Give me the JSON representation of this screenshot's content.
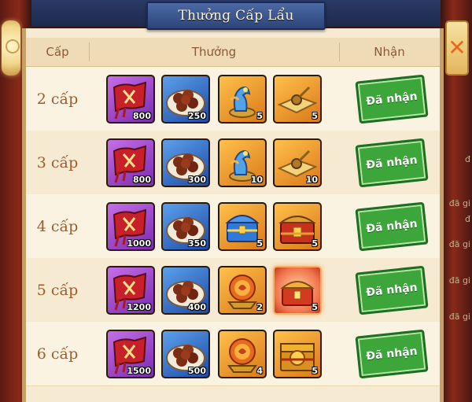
{
  "window": {
    "title": "Thưởng Cấp Lẩu"
  },
  "headers": {
    "level": "Cấp",
    "reward": "Thưởng",
    "claim": "Nhận"
  },
  "side_text": [
    "đ",
    "đã gi",
    "đ",
    "đã gi",
    "đã gi",
    "đã gi"
  ],
  "claimed_label": "Đã nhận",
  "rows": [
    {
      "level": "2 cấp",
      "items": [
        {
          "name": "red-banner-icon",
          "rarity": "purple",
          "qty": "800"
        },
        {
          "name": "chestnut-plate-icon",
          "rarity": "blue",
          "qty": "250"
        },
        {
          "name": "blue-dragon-statue-icon",
          "rarity": "orange",
          "qty": "5"
        },
        {
          "name": "golden-tray-icon",
          "rarity": "orange",
          "qty": "5"
        }
      ]
    },
    {
      "level": "3 cấp",
      "items": [
        {
          "name": "red-banner-icon",
          "rarity": "purple",
          "qty": "800"
        },
        {
          "name": "chestnut-plate-icon",
          "rarity": "blue",
          "qty": "300"
        },
        {
          "name": "blue-dragon-statue-icon",
          "rarity": "orange",
          "qty": "10"
        },
        {
          "name": "golden-tray-icon",
          "rarity": "orange",
          "qty": "10"
        }
      ]
    },
    {
      "level": "4 cấp",
      "items": [
        {
          "name": "red-banner-icon",
          "rarity": "purple",
          "qty": "1000"
        },
        {
          "name": "chestnut-plate-icon",
          "rarity": "blue",
          "qty": "350"
        },
        {
          "name": "blue-treasure-chest-icon",
          "rarity": "orange",
          "qty": "5"
        },
        {
          "name": "gold-treasure-chest-icon",
          "rarity": "orange",
          "qty": "5"
        }
      ]
    },
    {
      "level": "5 cấp",
      "items": [
        {
          "name": "red-banner-icon",
          "rarity": "purple",
          "qty": "1200"
        },
        {
          "name": "chestnut-plate-icon",
          "rarity": "blue",
          "qty": "400"
        },
        {
          "name": "gold-coin-stand-icon",
          "rarity": "orange",
          "qty": "2"
        },
        {
          "name": "glowing-treasure-chest-icon",
          "rarity": "red",
          "qty": "5"
        }
      ]
    },
    {
      "level": "6 cấp",
      "items": [
        {
          "name": "red-banner-icon",
          "rarity": "purple",
          "qty": "1500"
        },
        {
          "name": "chestnut-plate-icon",
          "rarity": "blue",
          "qty": "500"
        },
        {
          "name": "gold-coin-stand-icon",
          "rarity": "orange",
          "qty": "4"
        },
        {
          "name": "gold-coin-box-icon",
          "rarity": "orange",
          "qty": "5"
        }
      ]
    }
  ],
  "colors": {
    "panel": "#f6ead2",
    "header": "#efdcb6",
    "claimed_green": "#3da63b",
    "title_blue": "#2d4479",
    "level_text": "#9b5e30"
  }
}
